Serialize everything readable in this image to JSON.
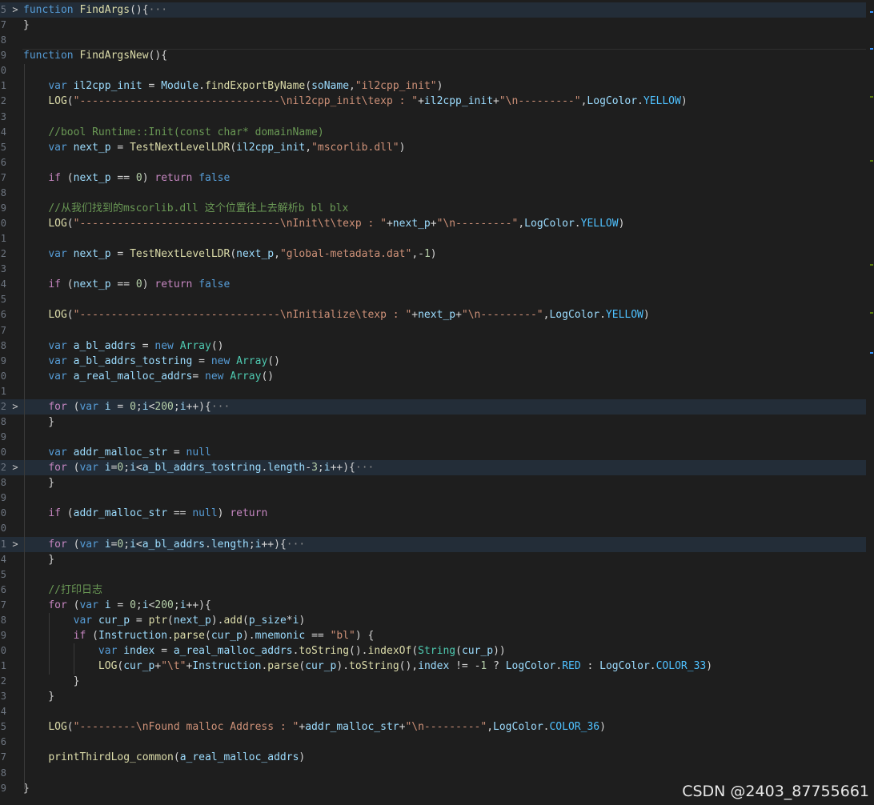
{
  "watermark": "CSDN @2403_87755661",
  "lines": [
    {
      "num": "5",
      "fold": ">",
      "folded": true,
      "tokens": [
        {
          "t": "function ",
          "c": "kw"
        },
        {
          "t": "FindArgs",
          "c": "fn"
        },
        {
          "t": "(){"
        },
        {
          "t": "···",
          "c": "ell"
        }
      ]
    },
    {
      "num": "7",
      "tokens": [
        {
          "t": "}"
        }
      ]
    },
    {
      "num": "8",
      "tokens": []
    },
    {
      "num": "9",
      "tokens": [
        {
          "t": "function ",
          "c": "kw"
        },
        {
          "t": "FindArgsNew",
          "c": "fn"
        },
        {
          "t": "(){"
        }
      ]
    },
    {
      "num": "0",
      "tokens": []
    },
    {
      "num": "1",
      "tokens": [
        {
          "t": "    "
        },
        {
          "t": "var ",
          "c": "kw"
        },
        {
          "t": "il2cpp_init",
          "c": "var"
        },
        {
          "t": " = "
        },
        {
          "t": "Module",
          "c": "var"
        },
        {
          "t": "."
        },
        {
          "t": "findExportByName",
          "c": "fn"
        },
        {
          "t": "("
        },
        {
          "t": "soName",
          "c": "var"
        },
        {
          "t": ","
        },
        {
          "t": "\"il2cpp_init\"",
          "c": "str"
        },
        {
          "t": ")"
        }
      ]
    },
    {
      "num": "2",
      "tokens": [
        {
          "t": "    "
        },
        {
          "t": "LOG",
          "c": "fn"
        },
        {
          "t": "("
        },
        {
          "t": "\"--------------------------------\\nil2cpp_init\\texp : \"",
          "c": "str"
        },
        {
          "t": "+"
        },
        {
          "t": "il2cpp_init",
          "c": "var"
        },
        {
          "t": "+"
        },
        {
          "t": "\"\\n---------\"",
          "c": "str"
        },
        {
          "t": ","
        },
        {
          "t": "LogColor",
          "c": "var"
        },
        {
          "t": "."
        },
        {
          "t": "YELLOW",
          "c": "prop"
        },
        {
          "t": ")"
        }
      ]
    },
    {
      "num": "3",
      "tokens": []
    },
    {
      "num": "4",
      "tokens": [
        {
          "t": "    "
        },
        {
          "t": "//bool Runtime::Init(const char* domainName)",
          "c": "cm"
        }
      ]
    },
    {
      "num": "5",
      "tokens": [
        {
          "t": "    "
        },
        {
          "t": "var ",
          "c": "kw"
        },
        {
          "t": "next_p",
          "c": "var"
        },
        {
          "t": " = "
        },
        {
          "t": "TestNextLevelLDR",
          "c": "fn"
        },
        {
          "t": "("
        },
        {
          "t": "il2cpp_init",
          "c": "var"
        },
        {
          "t": ","
        },
        {
          "t": "\"mscorlib.dll\"",
          "c": "str"
        },
        {
          "t": ")"
        }
      ]
    },
    {
      "num": "6",
      "tokens": []
    },
    {
      "num": "7",
      "tokens": [
        {
          "t": "    "
        },
        {
          "t": "if ",
          "c": "ctrl"
        },
        {
          "t": "("
        },
        {
          "t": "next_p",
          "c": "var"
        },
        {
          "t": " == "
        },
        {
          "t": "0",
          "c": "num"
        },
        {
          "t": ") "
        },
        {
          "t": "return ",
          "c": "ctrl"
        },
        {
          "t": "false",
          "c": "kw"
        }
      ]
    },
    {
      "num": "8",
      "tokens": []
    },
    {
      "num": "9",
      "tokens": [
        {
          "t": "    "
        },
        {
          "t": "//从我们找到的mscorlib.dll 这个位置往上去解析b bl blx",
          "c": "cm"
        }
      ]
    },
    {
      "num": "0",
      "tokens": [
        {
          "t": "    "
        },
        {
          "t": "LOG",
          "c": "fn"
        },
        {
          "t": "("
        },
        {
          "t": "\"--------------------------------\\nInit\\t\\texp : \"",
          "c": "str"
        },
        {
          "t": "+"
        },
        {
          "t": "next_p",
          "c": "var"
        },
        {
          "t": "+"
        },
        {
          "t": "\"\\n---------\"",
          "c": "str"
        },
        {
          "t": ","
        },
        {
          "t": "LogColor",
          "c": "var"
        },
        {
          "t": "."
        },
        {
          "t": "YELLOW",
          "c": "prop"
        },
        {
          "t": ")"
        }
      ]
    },
    {
      "num": "1",
      "tokens": []
    },
    {
      "num": "2",
      "tokens": [
        {
          "t": "    "
        },
        {
          "t": "var ",
          "c": "kw"
        },
        {
          "t": "next_p",
          "c": "var"
        },
        {
          "t": " = "
        },
        {
          "t": "TestNextLevelLDR",
          "c": "fn"
        },
        {
          "t": "("
        },
        {
          "t": "next_p",
          "c": "var"
        },
        {
          "t": ","
        },
        {
          "t": "\"global-metadata.dat\"",
          "c": "str"
        },
        {
          "t": ",-"
        },
        {
          "t": "1",
          "c": "num"
        },
        {
          "t": ")"
        }
      ]
    },
    {
      "num": "3",
      "tokens": []
    },
    {
      "num": "4",
      "tokens": [
        {
          "t": "    "
        },
        {
          "t": "if ",
          "c": "ctrl"
        },
        {
          "t": "("
        },
        {
          "t": "next_p",
          "c": "var"
        },
        {
          "t": " == "
        },
        {
          "t": "0",
          "c": "num"
        },
        {
          "t": ") "
        },
        {
          "t": "return ",
          "c": "ctrl"
        },
        {
          "t": "false",
          "c": "kw"
        }
      ]
    },
    {
      "num": "5",
      "tokens": []
    },
    {
      "num": "6",
      "tokens": [
        {
          "t": "    "
        },
        {
          "t": "LOG",
          "c": "fn"
        },
        {
          "t": "("
        },
        {
          "t": "\"--------------------------------\\nInitialize\\texp : \"",
          "c": "str"
        },
        {
          "t": "+"
        },
        {
          "t": "next_p",
          "c": "var"
        },
        {
          "t": "+"
        },
        {
          "t": "\"\\n---------\"",
          "c": "str"
        },
        {
          "t": ","
        },
        {
          "t": "LogColor",
          "c": "var"
        },
        {
          "t": "."
        },
        {
          "t": "YELLOW",
          "c": "prop"
        },
        {
          "t": ")"
        }
      ]
    },
    {
      "num": "7",
      "tokens": []
    },
    {
      "num": "8",
      "tokens": [
        {
          "t": "    "
        },
        {
          "t": "var ",
          "c": "kw"
        },
        {
          "t": "a_bl_addrs",
          "c": "var"
        },
        {
          "t": " = "
        },
        {
          "t": "new ",
          "c": "kw"
        },
        {
          "t": "Array",
          "c": "cls"
        },
        {
          "t": "()"
        }
      ]
    },
    {
      "num": "9",
      "tokens": [
        {
          "t": "    "
        },
        {
          "t": "var ",
          "c": "kw"
        },
        {
          "t": "a_bl_addrs_tostring",
          "c": "var"
        },
        {
          "t": " = "
        },
        {
          "t": "new ",
          "c": "kw"
        },
        {
          "t": "Array",
          "c": "cls"
        },
        {
          "t": "()"
        }
      ]
    },
    {
      "num": "0",
      "tokens": [
        {
          "t": "    "
        },
        {
          "t": "var ",
          "c": "kw"
        },
        {
          "t": "a_real_malloc_addrs",
          "c": "var"
        },
        {
          "t": "= "
        },
        {
          "t": "new ",
          "c": "kw"
        },
        {
          "t": "Array",
          "c": "cls"
        },
        {
          "t": "()"
        }
      ]
    },
    {
      "num": "1",
      "tokens": []
    },
    {
      "num": "2",
      "fold": ">",
      "folded": true,
      "tokens": [
        {
          "t": "    "
        },
        {
          "t": "for ",
          "c": "ctrl"
        },
        {
          "t": "("
        },
        {
          "t": "var ",
          "c": "kw"
        },
        {
          "t": "i",
          "c": "var"
        },
        {
          "t": " = "
        },
        {
          "t": "0",
          "c": "num"
        },
        {
          "t": ";"
        },
        {
          "t": "i",
          "c": "var"
        },
        {
          "t": "<"
        },
        {
          "t": "200",
          "c": "num"
        },
        {
          "t": ";"
        },
        {
          "t": "i",
          "c": "var"
        },
        {
          "t": "++){"
        },
        {
          "t": "···",
          "c": "ell"
        }
      ]
    },
    {
      "num": "8",
      "tokens": [
        {
          "t": "    }"
        }
      ]
    },
    {
      "num": "9",
      "tokens": []
    },
    {
      "num": "0",
      "tokens": [
        {
          "t": "    "
        },
        {
          "t": "var ",
          "c": "kw"
        },
        {
          "t": "addr_malloc_str",
          "c": "var"
        },
        {
          "t": " = "
        },
        {
          "t": "null",
          "c": "kw"
        }
      ]
    },
    {
      "num": "2",
      "fold": ">",
      "folded": true,
      "tokens": [
        {
          "t": "    "
        },
        {
          "t": "for ",
          "c": "ctrl"
        },
        {
          "t": "("
        },
        {
          "t": "var ",
          "c": "kw"
        },
        {
          "t": "i",
          "c": "var"
        },
        {
          "t": "="
        },
        {
          "t": "0",
          "c": "num"
        },
        {
          "t": ";"
        },
        {
          "t": "i",
          "c": "var"
        },
        {
          "t": "<"
        },
        {
          "t": "a_bl_addrs_tostring",
          "c": "var"
        },
        {
          "t": "."
        },
        {
          "t": "length",
          "c": "var"
        },
        {
          "t": "-"
        },
        {
          "t": "3",
          "c": "num"
        },
        {
          "t": ";"
        },
        {
          "t": "i",
          "c": "var"
        },
        {
          "t": "++){"
        },
        {
          "t": "···",
          "c": "ell"
        }
      ]
    },
    {
      "num": "8",
      "tokens": [
        {
          "t": "    }"
        }
      ]
    },
    {
      "num": "9",
      "tokens": []
    },
    {
      "num": "0",
      "tokens": [
        {
          "t": "    "
        },
        {
          "t": "if ",
          "c": "ctrl"
        },
        {
          "t": "("
        },
        {
          "t": "addr_malloc_str",
          "c": "var"
        },
        {
          "t": " == "
        },
        {
          "t": "null",
          "c": "kw"
        },
        {
          "t": ") "
        },
        {
          "t": "return",
          "c": "ctrl"
        }
      ]
    },
    {
      "num": "0",
      "tokens": []
    },
    {
      "num": "1",
      "fold": ">",
      "folded": true,
      "tokens": [
        {
          "t": "    "
        },
        {
          "t": "for ",
          "c": "ctrl"
        },
        {
          "t": "("
        },
        {
          "t": "var ",
          "c": "kw"
        },
        {
          "t": "i",
          "c": "var"
        },
        {
          "t": "="
        },
        {
          "t": "0",
          "c": "num"
        },
        {
          "t": ";"
        },
        {
          "t": "i",
          "c": "var"
        },
        {
          "t": "<"
        },
        {
          "t": "a_bl_addrs",
          "c": "var"
        },
        {
          "t": "."
        },
        {
          "t": "length",
          "c": "var"
        },
        {
          "t": ";"
        },
        {
          "t": "i",
          "c": "var"
        },
        {
          "t": "++){"
        },
        {
          "t": "···",
          "c": "ell"
        }
      ]
    },
    {
      "num": "4",
      "tokens": [
        {
          "t": "    }"
        }
      ]
    },
    {
      "num": "5",
      "tokens": []
    },
    {
      "num": "6",
      "tokens": [
        {
          "t": "    "
        },
        {
          "t": "//打印日志",
          "c": "cm"
        }
      ]
    },
    {
      "num": "7",
      "tokens": [
        {
          "t": "    "
        },
        {
          "t": "for ",
          "c": "ctrl"
        },
        {
          "t": "("
        },
        {
          "t": "var ",
          "c": "kw"
        },
        {
          "t": "i",
          "c": "var"
        },
        {
          "t": " = "
        },
        {
          "t": "0",
          "c": "num"
        },
        {
          "t": ";"
        },
        {
          "t": "i",
          "c": "var"
        },
        {
          "t": "<"
        },
        {
          "t": "200",
          "c": "num"
        },
        {
          "t": ";"
        },
        {
          "t": "i",
          "c": "var"
        },
        {
          "t": "++){"
        }
      ]
    },
    {
      "num": "8",
      "tokens": [
        {
          "t": "        "
        },
        {
          "t": "var ",
          "c": "kw"
        },
        {
          "t": "cur_p",
          "c": "var"
        },
        {
          "t": " = "
        },
        {
          "t": "ptr",
          "c": "fn"
        },
        {
          "t": "("
        },
        {
          "t": "next_p",
          "c": "var"
        },
        {
          "t": ")."
        },
        {
          "t": "add",
          "c": "fn"
        },
        {
          "t": "("
        },
        {
          "t": "p_size",
          "c": "var"
        },
        {
          "t": "*"
        },
        {
          "t": "i",
          "c": "var"
        },
        {
          "t": ")"
        }
      ]
    },
    {
      "num": "9",
      "tokens": [
        {
          "t": "        "
        },
        {
          "t": "if ",
          "c": "ctrl"
        },
        {
          "t": "("
        },
        {
          "t": "Instruction",
          "c": "var"
        },
        {
          "t": "."
        },
        {
          "t": "parse",
          "c": "fn"
        },
        {
          "t": "("
        },
        {
          "t": "cur_p",
          "c": "var"
        },
        {
          "t": ")."
        },
        {
          "t": "mnemonic",
          "c": "var"
        },
        {
          "t": " == "
        },
        {
          "t": "\"bl\"",
          "c": "str"
        },
        {
          "t": ") {"
        }
      ]
    },
    {
      "num": "0",
      "tokens": [
        {
          "t": "            "
        },
        {
          "t": "var ",
          "c": "kw"
        },
        {
          "t": "index",
          "c": "var"
        },
        {
          "t": " = "
        },
        {
          "t": "a_real_malloc_addrs",
          "c": "var"
        },
        {
          "t": "."
        },
        {
          "t": "toString",
          "c": "fn"
        },
        {
          "t": "()."
        },
        {
          "t": "indexOf",
          "c": "fn"
        },
        {
          "t": "("
        },
        {
          "t": "String",
          "c": "cls"
        },
        {
          "t": "("
        },
        {
          "t": "cur_p",
          "c": "var"
        },
        {
          "t": "))"
        }
      ]
    },
    {
      "num": "1",
      "tokens": [
        {
          "t": "            "
        },
        {
          "t": "LOG",
          "c": "fn"
        },
        {
          "t": "("
        },
        {
          "t": "cur_p",
          "c": "var"
        },
        {
          "t": "+"
        },
        {
          "t": "\"\\t\"",
          "c": "str"
        },
        {
          "t": "+"
        },
        {
          "t": "Instruction",
          "c": "var"
        },
        {
          "t": "."
        },
        {
          "t": "parse",
          "c": "fn"
        },
        {
          "t": "("
        },
        {
          "t": "cur_p",
          "c": "var"
        },
        {
          "t": ")."
        },
        {
          "t": "toString",
          "c": "fn"
        },
        {
          "t": "(),"
        },
        {
          "t": "index",
          "c": "var"
        },
        {
          "t": " != -"
        },
        {
          "t": "1",
          "c": "num"
        },
        {
          "t": " ? "
        },
        {
          "t": "LogColor",
          "c": "var"
        },
        {
          "t": "."
        },
        {
          "t": "RED",
          "c": "prop"
        },
        {
          "t": " : "
        },
        {
          "t": "LogColor",
          "c": "var"
        },
        {
          "t": "."
        },
        {
          "t": "COLOR_33",
          "c": "prop"
        },
        {
          "t": ")"
        }
      ]
    },
    {
      "num": "2",
      "tokens": [
        {
          "t": "        }"
        }
      ]
    },
    {
      "num": "3",
      "tokens": [
        {
          "t": "    }"
        }
      ]
    },
    {
      "num": "4",
      "tokens": []
    },
    {
      "num": "5",
      "tokens": [
        {
          "t": "    "
        },
        {
          "t": "LOG",
          "c": "fn"
        },
        {
          "t": "("
        },
        {
          "t": "\"---------\\nFound malloc Address : \"",
          "c": "str"
        },
        {
          "t": "+"
        },
        {
          "t": "addr_malloc_str",
          "c": "var"
        },
        {
          "t": "+"
        },
        {
          "t": "\"\\n---------\"",
          "c": "str"
        },
        {
          "t": ","
        },
        {
          "t": "LogColor",
          "c": "var"
        },
        {
          "t": "."
        },
        {
          "t": "COLOR_36",
          "c": "prop"
        },
        {
          "t": ")"
        }
      ]
    },
    {
      "num": "6",
      "tokens": []
    },
    {
      "num": "7",
      "tokens": [
        {
          "t": "    "
        },
        {
          "t": "printThirdLog_common",
          "c": "fn"
        },
        {
          "t": "("
        },
        {
          "t": "a_real_malloc_addrs",
          "c": "var"
        },
        {
          "t": ")"
        }
      ]
    },
    {
      "num": "8",
      "tokens": []
    },
    {
      "num": "9",
      "tokens": [
        {
          "t": "}"
        }
      ]
    }
  ]
}
